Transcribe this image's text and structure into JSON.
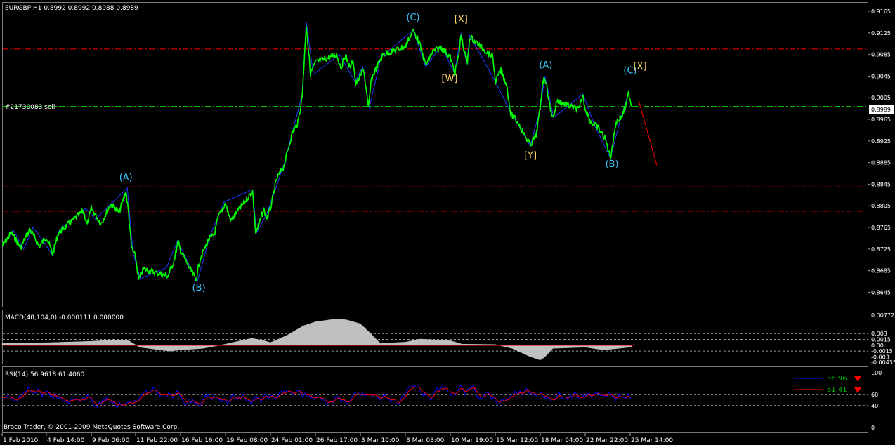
{
  "header": {
    "symbol_info": "EURGBP,H1  0.8992 0.8992 0.8988 0.8989"
  },
  "order_line": {
    "label": "#21730083 sell",
    "price_box": "0.8989"
  },
  "footer": {
    "copyright": "Broco Trader, © 2001-2009 MetaQuotes Software Corp."
  },
  "colors": {
    "background": "#000000",
    "price_line": "#00ff00",
    "wave_line": "#1e3cff",
    "resistance_line": "#ff0000",
    "order_line": "#00c000",
    "wave_label_cyan": "#3cc8ff",
    "wave_label_yellow": "#ffd860",
    "macd_hist": "#c0c0c0",
    "macd_signal": "#ff0000",
    "rsi_main": "#0000ff",
    "rsi_signal": "#ff0000",
    "rsi_legend_text": "#00c000"
  },
  "chart_data": [
    {
      "type": "line",
      "title": "EURGBP,H1",
      "y_ticks": [
        "0.9165",
        "0.9125",
        "0.9085",
        "0.9045",
        "0.9005",
        "0.8965",
        "0.8925",
        "0.8885",
        "0.8845",
        "0.8805",
        "0.8765",
        "0.8725",
        "0.8685",
        "0.8645"
      ],
      "ylim": [
        0.8635,
        0.9175
      ],
      "x_ticks": [
        "1 Feb 2010",
        "4 Feb 14:00",
        "9 Feb 06:00",
        "11 Feb 22:00",
        "16 Feb 16:00",
        "19 Feb 08:00",
        "24 Feb 01:00",
        "26 Feb 17:00",
        "3 Mar 10:00",
        "8 Mar 03:00",
        "10 Mar 19:00",
        "15 Mar 12:00",
        "18 Mar 04:00",
        "22 Mar 22:00",
        "25 Mar 14:00"
      ],
      "x_tick_dates": [
        "2010-02-01",
        "2010-02-04 14:00",
        "2010-02-09 06:00",
        "2010-02-11 22:00",
        "2010-02-16 16:00",
        "2010-02-19 08:00",
        "2010-02-24 01:00",
        "2010-02-26 17:00",
        "2010-03-03 10:00",
        "2010-03-08 03:00",
        "2010-03-10 19:00",
        "2010-03-15 12:00",
        "2010-03-18 04:00",
        "2010-03-22 22:00",
        "2010-03-25 14:00"
      ],
      "price_path": [
        [
          "2010-02-01 00:00",
          0.873
        ],
        [
          "2010-02-01 18:00",
          0.8755
        ],
        [
          "2010-02-02 12:00",
          0.8728
        ],
        [
          "2010-02-03 06:00",
          0.8762
        ],
        [
          "2010-02-04 00:00",
          0.873
        ],
        [
          "2010-02-04 14:00",
          0.8748
        ],
        [
          "2010-02-05 06:00",
          0.8715
        ],
        [
          "2010-02-05 20:00",
          0.8755
        ],
        [
          "2010-02-08 10:00",
          0.8795
        ],
        [
          "2010-02-08 20:00",
          0.877
        ],
        [
          "2010-02-09 06:00",
          0.88
        ],
        [
          "2010-02-09 20:00",
          0.8772
        ],
        [
          "2010-02-10 10:00",
          0.8808
        ],
        [
          "2010-02-10 22:00",
          0.8792
        ],
        [
          "2010-02-11 08:00",
          0.8832
        ],
        [
          "2010-02-11 12:00",
          0.879
        ],
        [
          "2010-02-11 16:00",
          0.8728
        ],
        [
          "2010-02-11 22:00",
          0.871
        ],
        [
          "2010-02-12 06:00",
          0.8668
        ],
        [
          "2010-02-12 18:00",
          0.8688
        ],
        [
          "2010-02-15 08:00",
          0.8675
        ],
        [
          "2010-02-15 22:00",
          0.87
        ],
        [
          "2010-02-16 10:00",
          0.8738
        ],
        [
          "2010-02-16 16:00",
          0.8722
        ],
        [
          "2010-02-17 04:00",
          0.8692
        ],
        [
          "2010-02-17 14:00",
          0.8668
        ],
        [
          "2010-02-17 20:00",
          0.8708
        ],
        [
          "2010-02-18 08:00",
          0.8742
        ],
        [
          "2010-02-18 16:00",
          0.8752
        ],
        [
          "2010-02-18 22:00",
          0.8785
        ],
        [
          "2010-02-19 08:00",
          0.881
        ],
        [
          "2010-02-19 16:00",
          0.8788
        ],
        [
          "2010-02-19 22:00",
          0.8778
        ],
        [
          "2010-02-22 04:00",
          0.8832
        ],
        [
          "2010-02-22 12:00",
          0.8755
        ],
        [
          "2010-02-22 20:00",
          0.877
        ],
        [
          "2010-02-23 08:00",
          0.8798
        ],
        [
          "2010-02-23 16:00",
          0.8782
        ],
        [
          "2010-02-24 01:00",
          0.88
        ],
        [
          "2010-02-24 10:00",
          0.8855
        ],
        [
          "2010-02-24 20:00",
          0.8878
        ],
        [
          "2010-02-25 08:00",
          0.894
        ],
        [
          "2010-02-25 16:00",
          0.8958
        ],
        [
          "2010-02-25 22:00",
          0.9005
        ],
        [
          "2010-02-26 04:00",
          0.914
        ],
        [
          "2010-02-26 10:00",
          0.905
        ],
        [
          "2010-02-26 17:00",
          0.907
        ],
        [
          "2010-02-28 22:00",
          0.9085
        ],
        [
          "2010-03-01 10:00",
          0.906
        ],
        [
          "2010-03-01 20:00",
          0.9085
        ],
        [
          "2010-03-02 08:00",
          0.906
        ],
        [
          "2010-03-02 16:00",
          0.9075
        ],
        [
          "2010-03-02 22:00",
          0.903
        ],
        [
          "2010-03-03 10:00",
          0.9045
        ],
        [
          "2010-03-03 18:00",
          0.906
        ],
        [
          "2010-03-04 06:00",
          0.8985
        ],
        [
          "2010-03-04 14:00",
          0.904
        ],
        [
          "2010-03-05 02:00",
          0.906
        ],
        [
          "2010-03-05 12:00",
          0.9075
        ],
        [
          "2010-03-05 20:00",
          0.9085
        ],
        [
          "2010-03-08 03:00",
          0.91
        ],
        [
          "2010-03-08 14:00",
          0.913
        ],
        [
          "2010-03-08 22:00",
          0.911
        ],
        [
          "2010-03-09 08:00",
          0.9065
        ],
        [
          "2010-03-09 18:00",
          0.909
        ],
        [
          "2010-03-10 06:00",
          0.9098
        ],
        [
          "2010-03-10 19:00",
          0.908
        ],
        [
          "2010-03-11 06:00",
          0.905
        ],
        [
          "2010-03-11 16:00",
          0.9082
        ],
        [
          "2010-03-11 22:00",
          0.9122
        ],
        [
          "2010-03-12 06:00",
          0.909
        ],
        [
          "2010-03-12 14:00",
          0.907
        ],
        [
          "2010-03-12 20:00",
          0.9118
        ],
        [
          "2010-03-15 06:00",
          0.908
        ],
        [
          "2010-03-15 12:00",
          0.9035
        ],
        [
          "2010-03-15 20:00",
          0.9055
        ],
        [
          "2010-03-16 04:00",
          0.903
        ],
        [
          "2010-03-16 10:00",
          0.8975
        ],
        [
          "2010-03-16 20:00",
          0.896
        ],
        [
          "2010-03-17 06:00",
          0.8935
        ],
        [
          "2010-03-17 14:00",
          0.8918
        ],
        [
          "2010-03-17 22:00",
          0.8935
        ],
        [
          "2010-03-18 04:00",
          0.8985
        ],
        [
          "2010-03-18 10:00",
          0.9035
        ],
        [
          "2010-03-18 16:00",
          0.9042
        ],
        [
          "2010-03-18 22:00",
          0.902
        ],
        [
          "2010-03-19 06:00",
          0.898
        ],
        [
          "2010-03-19 14:00",
          0.897
        ],
        [
          "2010-03-19 22:00",
          0.9
        ],
        [
          "2010-03-22 06:00",
          0.8982
        ],
        [
          "2010-03-22 16:00",
          0.901
        ],
        [
          "2010-03-22 22:00",
          0.8985
        ],
        [
          "2010-03-23 06:00",
          0.896
        ],
        [
          "2010-03-23 16:00",
          0.895
        ],
        [
          "2010-03-24 02:00",
          0.893
        ],
        [
          "2010-03-24 10:00",
          0.8895
        ],
        [
          "2010-03-24 18:00",
          0.896
        ],
        [
          "2010-03-25 02:00",
          0.897
        ],
        [
          "2010-03-25 08:00",
          0.899
        ],
        [
          "2010-03-25 12:00",
          0.9015
        ],
        [
          "2010-03-25 16:00",
          0.8989
        ]
      ],
      "wave_path": [
        [
          "2010-02-01 00:00",
          0.873
        ],
        [
          "2010-02-01 22:00",
          0.876
        ],
        [
          "2010-02-02 18:00",
          0.8725
        ],
        [
          "2010-02-03 12:00",
          0.8765
        ],
        [
          "2010-02-04 08:00",
          0.874
        ],
        [
          "2010-02-05 04:00",
          0.8715
        ],
        [
          "2010-02-05 22:00",
          0.876
        ],
        [
          "2010-02-08 16:00",
          0.88
        ],
        [
          "2010-02-09 12:00",
          0.878
        ],
        [
          "2010-02-10 10:00",
          0.8808
        ],
        [
          "2010-02-11 10:00",
          0.8838
        ],
        [
          "2010-02-11 18:00",
          0.872
        ],
        [
          "2010-02-12 10:00",
          0.867
        ],
        [
          "2010-02-15 04:00",
          0.869
        ],
        [
          "2010-02-16 08:00",
          0.874
        ],
        [
          "2010-02-17 16:00",
          0.8665
        ],
        [
          "2010-02-18 10:00",
          0.875
        ],
        [
          "2010-02-19 06:00",
          0.8812
        ],
        [
          "2010-02-22 04:00",
          0.8835
        ],
        [
          "2010-02-22 14:00",
          0.8755
        ],
        [
          "2010-02-23 16:00",
          0.879
        ],
        [
          "2010-02-24 20:00",
          0.888
        ],
        [
          "2010-02-25 22:00",
          0.901
        ],
        [
          "2010-02-26 04:00",
          0.9145
        ],
        [
          "2010-02-26 14:00",
          0.9048
        ],
        [
          "2010-03-01 06:00",
          0.9085
        ],
        [
          "2010-03-02 20:00",
          0.9035
        ],
        [
          "2010-03-03 16:00",
          0.9062
        ],
        [
          "2010-03-04 08:00",
          0.8985
        ],
        [
          "2010-03-05 14:00",
          0.908
        ],
        [
          "2010-03-08 14:00",
          0.913
        ],
        [
          "2010-03-09 08:00",
          0.9062
        ],
        [
          "2010-03-10 06:00",
          0.91
        ],
        [
          "2010-03-11 06:00",
          0.905
        ],
        [
          "2010-03-11 22:00",
          0.9125
        ],
        [
          "2010-03-12 12:00",
          0.9068
        ],
        [
          "2010-03-12 20:00",
          0.912
        ],
        [
          "2010-03-15 12:00",
          0.9035
        ],
        [
          "2010-03-16 10:00",
          0.8978
        ],
        [
          "2010-03-17 14:00",
          0.8916
        ],
        [
          "2010-03-18 04:00",
          0.8985
        ],
        [
          "2010-03-18 16:00",
          0.9045
        ],
        [
          "2010-03-19 14:00",
          0.8968
        ],
        [
          "2010-03-22 16:00",
          0.9012
        ],
        [
          "2010-03-23 12:00",
          0.8952
        ],
        [
          "2010-03-24 10:00",
          0.8893
        ],
        [
          "2010-03-25 00:00",
          0.8965
        ],
        [
          "2010-03-25 12:00",
          0.9015
        ]
      ],
      "horizontal_lines": [
        {
          "price": 0.9095,
          "style": "red-dashdot"
        },
        {
          "price": 0.8989,
          "style": "green-dashdot",
          "label": "#21730083 sell"
        },
        {
          "price": 0.884,
          "style": "red-dashdot"
        },
        {
          "price": 0.8795,
          "style": "red-dashdot"
        }
      ],
      "projection": {
        "from": [
          "2010-03-26 02:00",
          0.9
        ],
        "to": [
          "2010-03-27 04:00",
          0.888
        ],
        "color": "#ff0000"
      },
      "wave_labels": [
        {
          "text": "(A)",
          "at": [
            "2010-02-11 08:00",
            0.8852
          ],
          "color": "cyan"
        },
        {
          "text": "(B)",
          "at": [
            "2010-02-17 18:00",
            0.8648
          ],
          "color": "cyan"
        },
        {
          "text": "(C)",
          "at": [
            "2010-03-08 14:00",
            0.9148
          ],
          "color": "cyan"
        },
        {
          "text": "[X]",
          "at": [
            "2010-03-11 22:00",
            0.9145
          ],
          "color": "yellow"
        },
        {
          "text": "[W]",
          "at": [
            "2010-03-10 18:00",
            0.9035
          ],
          "color": "yellow"
        },
        {
          "text": "[Y]",
          "at": [
            "2010-03-17 14:00",
            0.8893
          ],
          "color": "yellow"
        },
        {
          "text": "(A)",
          "at": [
            "2010-03-18 18:00",
            0.906
          ],
          "color": "cyan"
        },
        {
          "text": "(B)",
          "at": [
            "2010-03-24 12:00",
            0.8877
          ],
          "color": "cyan"
        },
        {
          "text": "(C)",
          "at": [
            "2010-03-25 14:00",
            0.905
          ],
          "color": "cyan"
        },
        {
          "text": "[X]",
          "at": [
            "2010-03-26 04:00",
            0.9058
          ],
          "color": "yellow"
        }
      ]
    },
    {
      "type": "area",
      "title": "MACD(48,104,0) -0.000111 0.000000",
      "y_ticks": [
        "0.00772",
        "0.003",
        "0.0015",
        "0.00",
        "-0.0015",
        "-0.003",
        "-0.00435"
      ],
      "dashed_levels": [
        0.003,
        0.0015,
        -0.0015,
        -0.003
      ],
      "ylim": [
        -0.00435,
        0.00772
      ],
      "signal_value": 0.0,
      "histogram": [
        [
          "2010-02-01 00:00",
          0.0005
        ],
        [
          "2010-02-03 00:00",
          0.0006
        ],
        [
          "2010-02-05 00:00",
          0.0007
        ],
        [
          "2010-02-09 00:00",
          0.001
        ],
        [
          "2010-02-10 20:00",
          0.0014
        ],
        [
          "2010-02-11 12:00",
          0.0012
        ],
        [
          "2010-02-12 08:00",
          -0.0005
        ],
        [
          "2010-02-15 12:00",
          -0.0015
        ],
        [
          "2010-02-16 16:00",
          -0.0012
        ],
        [
          "2010-02-18 00:00",
          -0.0008
        ],
        [
          "2010-02-19 08:00",
          0.0003
        ],
        [
          "2010-02-22 02:00",
          0.0018
        ],
        [
          "2010-02-23 08:00",
          0.0012
        ],
        [
          "2010-02-24 01:00",
          0.0007
        ],
        [
          "2010-02-25 00:00",
          0.0025
        ],
        [
          "2010-02-26 00:00",
          0.005
        ],
        [
          "2010-02-26 17:00",
          0.006
        ],
        [
          "2010-03-01 00:00",
          0.0068
        ],
        [
          "2010-03-02 00:00",
          0.0065
        ],
        [
          "2010-03-03 10:00",
          0.0055
        ],
        [
          "2010-03-04 12:00",
          0.003
        ],
        [
          "2010-03-05 12:00",
          0.0005
        ],
        [
          "2010-03-08 03:00",
          0.0008
        ],
        [
          "2010-03-09 00:00",
          0.0016
        ],
        [
          "2010-03-10 19:00",
          0.0012
        ],
        [
          "2010-03-12 00:00",
          0.0003
        ],
        [
          "2010-03-15 12:00",
          0.0002
        ],
        [
          "2010-03-16 12:00",
          -0.0008
        ],
        [
          "2010-03-17 12:00",
          -0.0028
        ],
        [
          "2010-03-18 04:00",
          -0.0038
        ],
        [
          "2010-03-18 16:00",
          -0.003
        ],
        [
          "2010-03-19 12:00",
          -0.0008
        ],
        [
          "2010-03-22 22:00",
          -0.0005
        ],
        [
          "2010-03-24 00:00",
          -0.0012
        ],
        [
          "2010-03-25 14:00",
          -0.0005
        ],
        [
          "2010-03-25 20:00",
          0.0003
        ]
      ]
    },
    {
      "type": "line",
      "title": "RSI(14) 56.9618 61.4060",
      "y_ticks": [
        "100",
        "60",
        "40",
        "0"
      ],
      "dashed_levels": [
        60,
        40
      ],
      "ylim": [
        0,
        100
      ],
      "series": [
        {
          "name": "",
          "color": "#0000ff",
          "values": []
        },
        {
          "name": "",
          "color": "#ff0000",
          "values": []
        }
      ],
      "legend": [
        {
          "value": "56.96",
          "color": "#0000ff"
        },
        {
          "value": "61.41",
          "color": "#ff0000"
        }
      ]
    }
  ]
}
